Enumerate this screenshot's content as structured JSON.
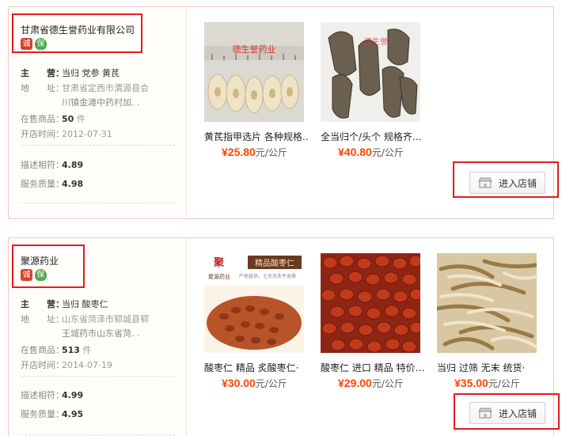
{
  "shops": [
    {
      "name": "甘肃省德生誉药业有限公司",
      "badges": [
        "诚",
        "保"
      ],
      "main_label": "主　　营：",
      "main_value": "当归 党参 黄芪",
      "addr_label": "地　　址：",
      "addr_line1": "甘肃省定西市渭源县会",
      "addr_line2": "川镇金滩中药村加. .",
      "onsale_label": "在售商品：",
      "onsale_count": "50",
      "onsale_unit": "件",
      "open_label": "开店时间：",
      "open_date": "2012-07-31",
      "desc_label": "描述相符：",
      "desc_score": "4.89",
      "service_label": "服务质量：",
      "service_score": "4.98",
      "enter_label": "进入店铺",
      "products": [
        {
          "title": "黄芪指甲选片 各种规格…",
          "price": "¥25.80",
          "unit": "元/公斤",
          "image": "huangqi-slices",
          "image_text": "德生誉药业"
        },
        {
          "title": "全当归个/头个 规格齐…",
          "price": "¥40.80",
          "unit": "元/公斤",
          "image": "danggui-roots",
          "image_text": "德生誉"
        }
      ]
    },
    {
      "name": "聚源药业",
      "badges": [
        "诚",
        "保"
      ],
      "main_label": "主　　营：",
      "main_value": "当归 酸枣仁",
      "addr_label": "地　　址：",
      "addr_line1": "山东省菏泽市郓城县郓",
      "addr_line2": "王城药市山东省菏. .",
      "onsale_label": "在售商品：",
      "onsale_count": "513",
      "onsale_unit": "件",
      "open_label": "开店时间：",
      "open_date": "2014-07-19",
      "desc_label": "描述相符：",
      "desc_score": "4.99",
      "service_label": "服务质量：",
      "service_score": "4.95",
      "enter_label": "进入店铺",
      "products": [
        {
          "title": "酸枣仁 精品 炙酸枣仁·",
          "price": "¥30.00",
          "unit": "元/公斤",
          "image": "jujube-seeds-ad",
          "image_text": "精品酸枣仁",
          "image_text2": "聚源药业",
          "image_text3": "产地直供，七天无条件退换"
        },
        {
          "title": "酸枣仁 进口 精品 特价…",
          "price": "¥29.00",
          "unit": "元/公斤",
          "image": "jujube-seeds"
        },
        {
          "title": "当归 过筛 无末 统货·",
          "price": "¥35.00",
          "unit": "元/公斤",
          "image": "danggui-shreds"
        }
      ]
    }
  ],
  "colors": {
    "price": "#ff4400",
    "highlight": "#e51c1c",
    "border": "#f0c9c2"
  }
}
